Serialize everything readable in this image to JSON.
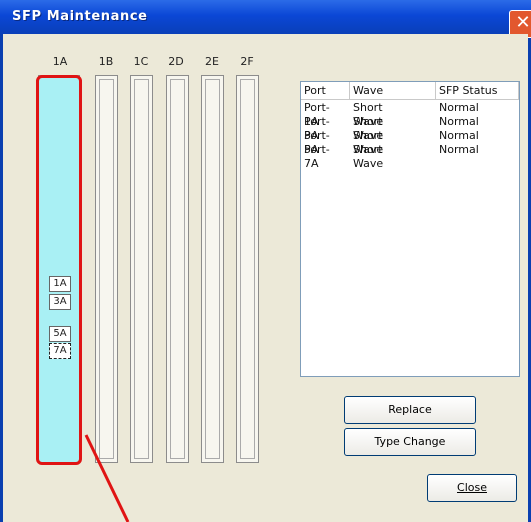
{
  "window": {
    "title": "SFP Maintenance",
    "close_glyph": "✕"
  },
  "columns": [
    "1A",
    "1B",
    "1C",
    "2D",
    "2E",
    "2F"
  ],
  "ports_1a": [
    "1A",
    "3A",
    "5A",
    "7A"
  ],
  "list": {
    "headers": [
      "Port",
      "Wave",
      "SFP Status"
    ],
    "rows": [
      {
        "port": "Port-1A",
        "wave": "Short Wave",
        "status": "Normal"
      },
      {
        "port": "Port-3A",
        "wave": "Short Wave",
        "status": "Normal"
      },
      {
        "port": "Port-5A",
        "wave": "Short Wave",
        "status": "Normal"
      },
      {
        "port": "Port-7A",
        "wave": "Short Wave",
        "status": "Normal"
      }
    ]
  },
  "buttons": {
    "replace": "Replace",
    "type_change": "Type Change",
    "close": "Close"
  },
  "colors": {
    "highlight": "#e01414",
    "selected_column": "#a9f0f4"
  }
}
